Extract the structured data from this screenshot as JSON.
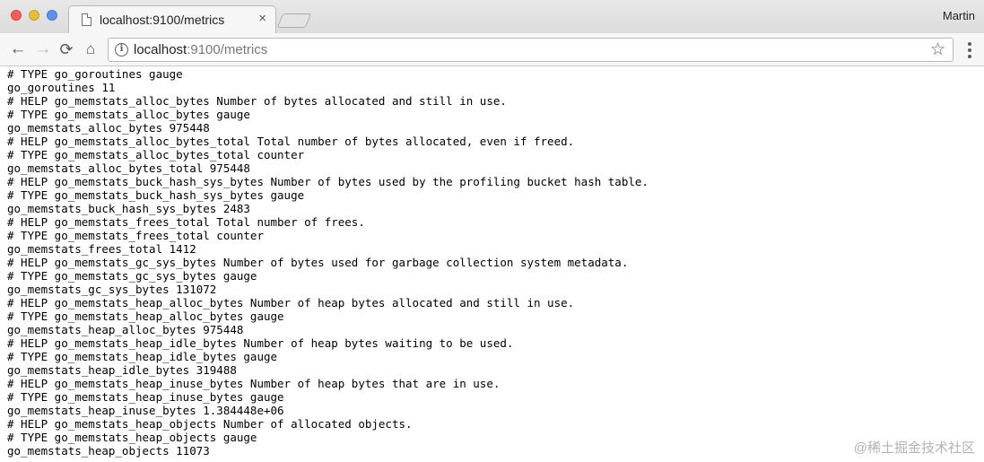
{
  "browser": {
    "tab_title": "localhost:9100/metrics",
    "tab_close": "×",
    "user_name": "Martin",
    "url_host": "localhost",
    "url_rest": ":9100/metrics",
    "icons": {
      "back": "←",
      "forward": "→",
      "reload": "⟳",
      "home": "⌂",
      "info": "i",
      "star": "☆"
    }
  },
  "metrics_lines": [
    "# TYPE go_goroutines gauge",
    "go_goroutines 11",
    "# HELP go_memstats_alloc_bytes Number of bytes allocated and still in use.",
    "# TYPE go_memstats_alloc_bytes gauge",
    "go_memstats_alloc_bytes 975448",
    "# HELP go_memstats_alloc_bytes_total Total number of bytes allocated, even if freed.",
    "# TYPE go_memstats_alloc_bytes_total counter",
    "go_memstats_alloc_bytes_total 975448",
    "# HELP go_memstats_buck_hash_sys_bytes Number of bytes used by the profiling bucket hash table.",
    "# TYPE go_memstats_buck_hash_sys_bytes gauge",
    "go_memstats_buck_hash_sys_bytes 2483",
    "# HELP go_memstats_frees_total Total number of frees.",
    "# TYPE go_memstats_frees_total counter",
    "go_memstats_frees_total 1412",
    "# HELP go_memstats_gc_sys_bytes Number of bytes used for garbage collection system metadata.",
    "# TYPE go_memstats_gc_sys_bytes gauge",
    "go_memstats_gc_sys_bytes 131072",
    "# HELP go_memstats_heap_alloc_bytes Number of heap bytes allocated and still in use.",
    "# TYPE go_memstats_heap_alloc_bytes gauge",
    "go_memstats_heap_alloc_bytes 975448",
    "# HELP go_memstats_heap_idle_bytes Number of heap bytes waiting to be used.",
    "# TYPE go_memstats_heap_idle_bytes gauge",
    "go_memstats_heap_idle_bytes 319488",
    "# HELP go_memstats_heap_inuse_bytes Number of heap bytes that are in use.",
    "# TYPE go_memstats_heap_inuse_bytes gauge",
    "go_memstats_heap_inuse_bytes 1.384448e+06",
    "# HELP go_memstats_heap_objects Number of allocated objects.",
    "# TYPE go_memstats_heap_objects gauge",
    "go_memstats_heap_objects 11073"
  ],
  "watermark": "@稀土掘金技术社区"
}
